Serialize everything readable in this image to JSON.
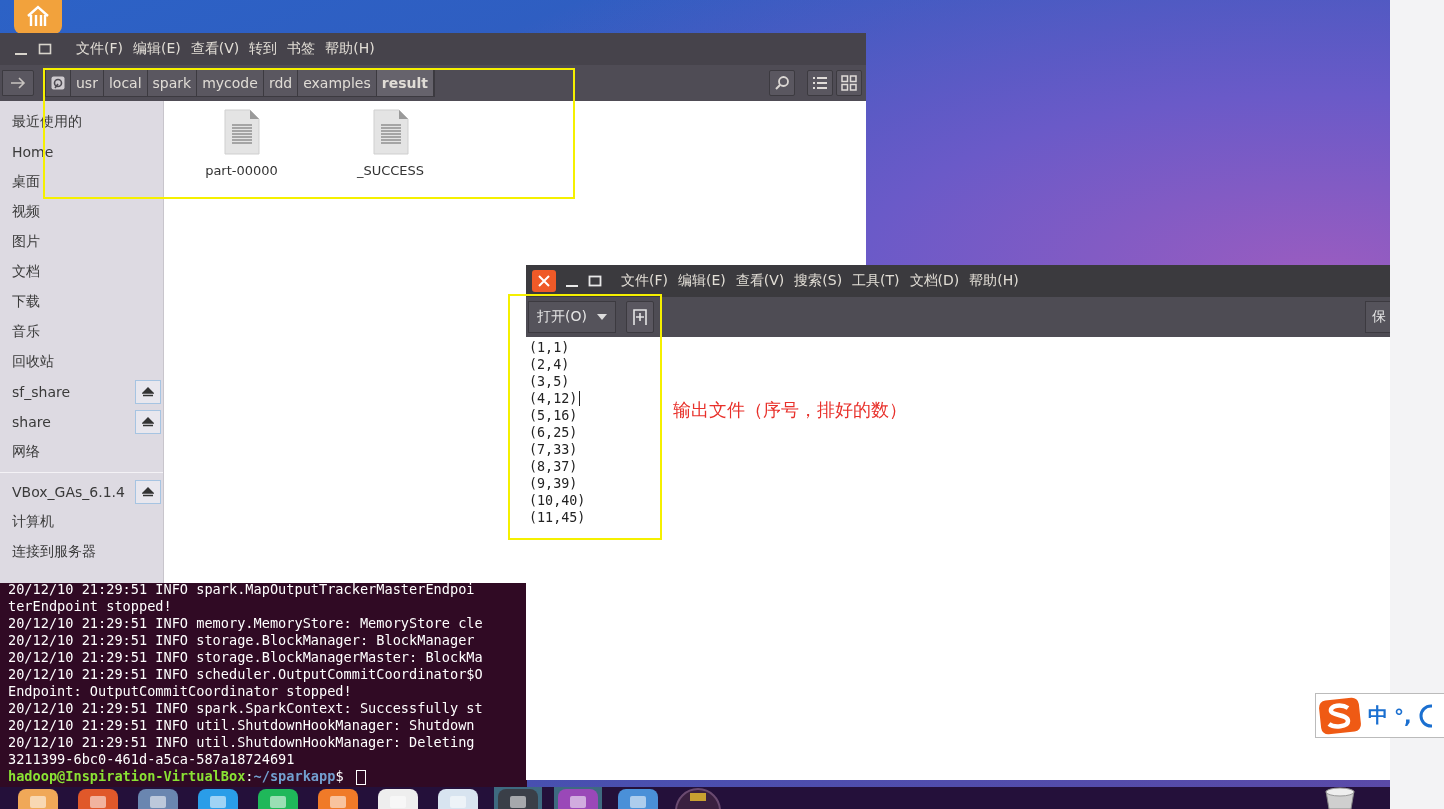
{
  "file_manager": {
    "menu": [
      "文件(F)",
      "编辑(E)",
      "查看(V)",
      "转到",
      "书签",
      "帮助(H)"
    ],
    "path": [
      {
        "label": "usr",
        "selected": false
      },
      {
        "label": "local",
        "selected": false
      },
      {
        "label": "spark",
        "selected": false
      },
      {
        "label": "mycode",
        "selected": false
      },
      {
        "label": "rdd",
        "selected": false
      },
      {
        "label": "examples",
        "selected": false
      },
      {
        "label": "result",
        "selected": true
      }
    ],
    "files": [
      {
        "name": "part-00000"
      },
      {
        "name": "_SUCCESS"
      }
    ],
    "sidebar": {
      "places": [
        {
          "label": "最近使用的",
          "ejectable": false
        },
        {
          "label": "Home",
          "ejectable": false
        },
        {
          "label": "桌面",
          "ejectable": false
        },
        {
          "label": "视频",
          "ejectable": false
        },
        {
          "label": "图片",
          "ejectable": false
        },
        {
          "label": "文档",
          "ejectable": false
        },
        {
          "label": "下载",
          "ejectable": false
        },
        {
          "label": "音乐",
          "ejectable": false
        },
        {
          "label": "回收站",
          "ejectable": false
        },
        {
          "label": "sf_share",
          "ejectable": true
        },
        {
          "label": "share",
          "ejectable": true
        },
        {
          "label": "网络",
          "ejectable": false
        }
      ],
      "devices": [
        {
          "label": "VBox_GAs_6.1.4",
          "ejectable": true
        },
        {
          "label": "计算机",
          "ejectable": false
        },
        {
          "label": "连接到服务器",
          "ejectable": false
        }
      ]
    }
  },
  "terminal": {
    "lines": [
      "20/12/10 21:29:51 INFO spark.MapOutputTrackerMasterEndpoi",
      "terEndpoint stopped!",
      "20/12/10 21:29:51 INFO memory.MemoryStore: MemoryStore cle",
      "20/12/10 21:29:51 INFO storage.BlockManager: BlockManager",
      "20/12/10 21:29:51 INFO storage.BlockManagerMaster: BlockMa",
      "20/12/10 21:29:51 INFO scheduler.OutputCommitCoordinator$O",
      "Endpoint: OutputCommitCoordinator stopped!",
      "20/12/10 21:29:51 INFO spark.SparkContext: Successfully st",
      "20/12/10 21:29:51 INFO util.ShutdownHookManager: Shutdown",
      "20/12/10 21:29:51 INFO util.ShutdownHookManager: Deleting",
      "3211399-6bc0-461d-a5ca-587a18724691"
    ],
    "prompt": {
      "user_host": "hadoop@Inspiration-VirtualBox",
      "separator": ":",
      "path": "~/sparkapp",
      "symbol": "$"
    }
  },
  "editor": {
    "menu": [
      "文件(F)",
      "编辑(E)",
      "查看(V)",
      "搜索(S)",
      "工具(T)",
      "文档(D)",
      "帮助(H)"
    ],
    "open_button": "打开(O)",
    "save_button": "保",
    "lines": [
      {
        "text": "(1,1)",
        "caret": false
      },
      {
        "text": "(2,4)",
        "caret": false
      },
      {
        "text": "(3,5)",
        "caret": false
      },
      {
        "text": "(4,12)",
        "caret": true
      },
      {
        "text": "(5,16)",
        "caret": false
      },
      {
        "text": "(6,25)",
        "caret": false
      },
      {
        "text": "(7,33)",
        "caret": false
      },
      {
        "text": "(8,37)",
        "caret": false
      },
      {
        "text": "(9,39)",
        "caret": false
      },
      {
        "text": "(10,40)",
        "caret": false
      },
      {
        "text": "(11,45)",
        "caret": false
      }
    ]
  },
  "annotation": "输出文件（序号，排好的数）",
  "ime": {
    "labels": [
      "中",
      "°,"
    ]
  }
}
